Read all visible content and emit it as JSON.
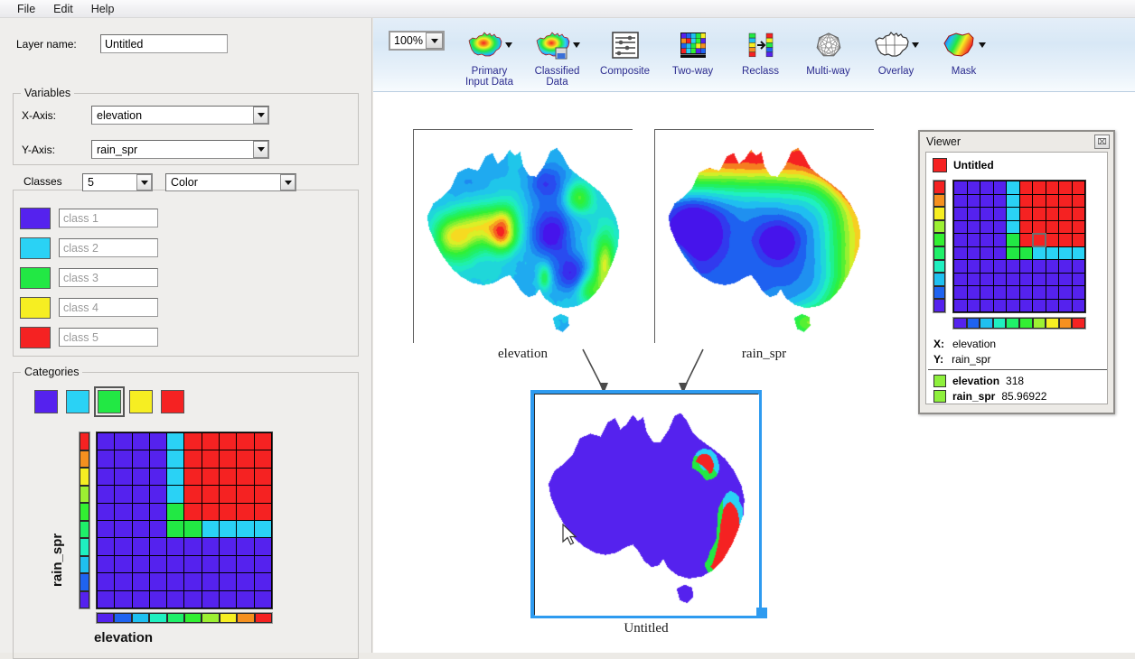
{
  "menubar": {
    "items": [
      {
        "label": "File"
      },
      {
        "label": "Edit"
      },
      {
        "label": "Help"
      }
    ]
  },
  "left_panel": {
    "layer_name": {
      "label": "Layer name:",
      "value": "Untitled"
    },
    "variables": {
      "title": "Variables",
      "x_axis": {
        "label": "X-Axis:",
        "value": "elevation"
      },
      "y_axis": {
        "label": "Y-Axis:",
        "value": "rain_spr"
      }
    },
    "classes": {
      "title": "Classes",
      "count": "5",
      "mode": "Color",
      "rows": [
        {
          "color": "#5522ee",
          "placeholder": "class 1"
        },
        {
          "color": "#2ad2f5",
          "placeholder": "class 2"
        },
        {
          "color": "#22e844",
          "placeholder": "class 3"
        },
        {
          "color": "#f6ee22",
          "placeholder": "class 4"
        },
        {
          "color": "#f52222",
          "placeholder": "class 5"
        }
      ]
    },
    "categories": {
      "title": "Categories",
      "swatches": [
        {
          "color": "#5522ee",
          "selected": false
        },
        {
          "color": "#2ad2f5",
          "selected": false
        },
        {
          "color": "#22e844",
          "selected": true
        },
        {
          "color": "#f6ee22",
          "selected": false
        },
        {
          "color": "#f52222",
          "selected": false
        }
      ],
      "x_label": "elevation",
      "y_label": "rain_spr"
    }
  },
  "toolbar": {
    "zoom_value": "100%",
    "buttons": [
      {
        "label": "Primary\nInput Data",
        "icon": "australia-map-icon",
        "dropdown": true
      },
      {
        "label": "Classified\nData",
        "icon": "australia-classified-icon",
        "dropdown": true
      },
      {
        "label": "Composite",
        "icon": "sliders-icon",
        "dropdown": false
      },
      {
        "label": "Two-way",
        "icon": "matrix-grid-icon",
        "dropdown": false
      },
      {
        "label": "Reclass",
        "icon": "reclass-arrow-icon",
        "dropdown": false
      },
      {
        "label": "Multi-way",
        "icon": "polygon-network-icon",
        "dropdown": false
      },
      {
        "label": "Overlay",
        "icon": "australia-outline-icon",
        "dropdown": true
      },
      {
        "label": "Mask",
        "icon": "region-mask-icon",
        "dropdown": true
      }
    ]
  },
  "canvas": {
    "maps": [
      {
        "name": "elevation",
        "caption": "elevation"
      },
      {
        "name": "rain_spr",
        "caption": "rain_spr"
      }
    ],
    "output": {
      "caption": "Untitled"
    }
  },
  "viewer": {
    "title": "Viewer",
    "close_label": "⌧",
    "layer_name": "Untitled",
    "layer_color": "#f52222",
    "x_label": "X:",
    "x_value": "elevation",
    "y_label": "Y:",
    "y_value": "rain_spr",
    "readouts": [
      {
        "color": "#8ef03c",
        "name": "elevation",
        "value": "318"
      },
      {
        "color": "#8ef03c",
        "name": "rain_spr",
        "value": "85.96922"
      }
    ]
  },
  "chart_data": {
    "type": "heatmap",
    "title": "Two-way classification matrix",
    "xlabel": "elevation",
    "ylabel": "rain_spr",
    "rows": 10,
    "cols": 10,
    "class_colors": [
      "#5522ee",
      "#2ad2f5",
      "#22e844",
      "#f6ee22",
      "#f52222"
    ],
    "class_labels": [
      "class 1",
      "class 2",
      "class 3",
      "class 4",
      "class 5"
    ],
    "cells": [
      [
        1,
        1,
        1,
        1,
        2,
        5,
        5,
        5,
        5,
        5
      ],
      [
        1,
        1,
        1,
        1,
        2,
        5,
        5,
        5,
        5,
        5
      ],
      [
        1,
        1,
        1,
        1,
        2,
        5,
        5,
        5,
        5,
        5
      ],
      [
        1,
        1,
        1,
        1,
        2,
        5,
        5,
        5,
        5,
        5
      ],
      [
        1,
        1,
        1,
        1,
        3,
        5,
        5,
        5,
        5,
        5
      ],
      [
        1,
        1,
        1,
        1,
        3,
        3,
        2,
        2,
        2,
        2
      ],
      [
        1,
        1,
        1,
        1,
        1,
        1,
        1,
        1,
        1,
        1
      ],
      [
        1,
        1,
        1,
        1,
        1,
        1,
        1,
        1,
        1,
        1
      ],
      [
        1,
        1,
        1,
        1,
        1,
        1,
        1,
        1,
        1,
        1
      ],
      [
        1,
        1,
        1,
        1,
        1,
        1,
        1,
        1,
        1,
        1
      ]
    ],
    "x_colorbar": [
      "#5522ee",
      "#1f63f0",
      "#1fc0f0",
      "#1ff0c0",
      "#1ff069",
      "#32f032",
      "#9cf032",
      "#f6ee22",
      "#f5901f",
      "#f52222"
    ],
    "y_colorbar": [
      "#f52222",
      "#f5901f",
      "#f6ee22",
      "#9cf032",
      "#32f032",
      "#1ff069",
      "#1ff0c0",
      "#1fc0f0",
      "#1f63f0",
      "#5522ee"
    ],
    "highlight_cell": {
      "row": 4,
      "col": 6
    }
  }
}
